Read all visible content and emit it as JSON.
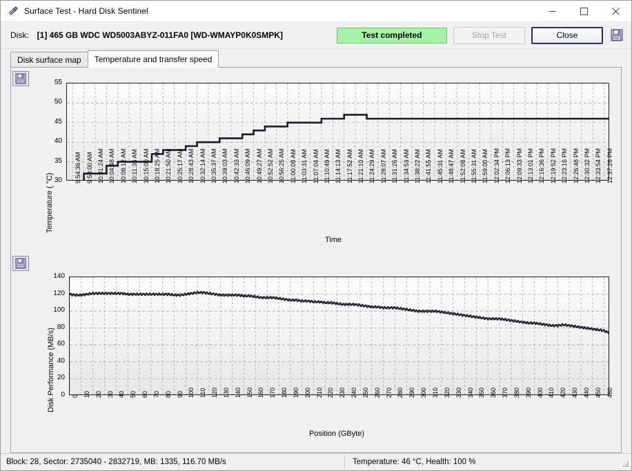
{
  "window": {
    "title": "Surface Test - Hard Disk Sentinel",
    "app_icon": "surface-test-icon",
    "minimize_label": "minimize-icon",
    "maximize_label": "maximize-icon",
    "close_label": "close-icon"
  },
  "diskbar": {
    "label": "Disk:",
    "value": "[1] 465 GB  WDC WD5003ABYZ-011FA0 [WD-WMAYP0K0SMPK]",
    "status": "Test completed",
    "status_bg": "#a6f2a6",
    "stop_button": "Stop Test",
    "close_button": "Close",
    "save_icon": "floppy-save-icon"
  },
  "tabs": [
    {
      "label": "Disk surface map",
      "active": false
    },
    {
      "label": "Temperature and transfer speed",
      "active": true
    }
  ],
  "statusbar": {
    "left": "Block: 28, Sector: 2735040 - 2832719, MB: 1335, 116.70 MB/s",
    "right": "Temperature: 46  °C,  Health: 100 %"
  },
  "chart_data": [
    {
      "id": "temperature-chart",
      "type": "line",
      "title": "",
      "xlabel": "Time",
      "ylabel": "Temperature ( °C)",
      "ylim": [
        30,
        55
      ],
      "yticks": [
        30,
        35,
        40,
        45,
        50,
        55
      ],
      "grid": true,
      "legend": null,
      "step_plot": true,
      "line_color": "#1a1a2e",
      "save_icon": "floppy-save-icon",
      "categories": [
        "9:54:36 AM",
        "9:58:00 AM",
        "10:01:24 AM",
        "10:04:48 AM",
        "10:08:12 AM",
        "10:11:36 AM",
        "10:15:00 AM",
        "10:18:25 AM",
        "10:21:50 AM",
        "10:25:17 AM",
        "10:28:43 AM",
        "10:32:14 AM",
        "10:35:37 AM",
        "10:39:03 AM",
        "10:42:33 AM",
        "10:46:09 AM",
        "10:49:27 AM",
        "10:52:52 AM",
        "10:56:25 AM",
        "11:00:08 AM",
        "11:03:31 AM",
        "11:07:04 AM",
        "11:10:49 AM",
        "11:14:13 AM",
        "11:17:52 AM",
        "11:21:10 AM",
        "11:24:29 AM",
        "11:28:07 AM",
        "11:31:26 AM",
        "11:34:53 AM",
        "11:38:22 AM",
        "11:41:55 AM",
        "11:45:31 AM",
        "11:48:47 AM",
        "11:52:08 AM",
        "11:55:31 AM",
        "11:59:00 AM",
        "12:02:34 PM",
        "12:06:13 PM",
        "12:09:33 PM",
        "12:13:01 PM",
        "12:16:36 PM",
        "12:19:52 PM",
        "12:23:16 PM",
        "12:26:48 PM",
        "12:30:32 PM",
        "12:33:54 PM",
        "12:37:26 PM"
      ],
      "values": [
        29,
        32,
        32,
        34,
        35,
        35,
        35,
        37,
        38,
        38,
        39,
        40,
        40,
        41,
        41,
        42,
        43,
        44,
        44,
        45,
        45,
        45,
        46,
        46,
        47,
        47,
        46,
        46,
        46,
        46,
        46,
        46,
        46,
        46,
        46,
        46,
        46,
        46,
        46,
        46,
        46,
        46,
        46,
        46,
        46,
        46,
        46,
        46
      ]
    },
    {
      "id": "disk-performance-chart",
      "type": "scatter",
      "title": "",
      "xlabel": "Position (GByte)",
      "ylabel": "Disk Performance (MB/s)",
      "ylim": [
        0,
        140
      ],
      "yticks": [
        0,
        20,
        40,
        60,
        80,
        100,
        120,
        140
      ],
      "xlim": [
        0,
        465
      ],
      "xticks": [
        0,
        10,
        20,
        30,
        40,
        50,
        60,
        70,
        80,
        90,
        100,
        110,
        120,
        130,
        140,
        150,
        160,
        170,
        180,
        190,
        200,
        210,
        220,
        230,
        240,
        250,
        260,
        270,
        280,
        290,
        300,
        310,
        320,
        330,
        340,
        350,
        360,
        370,
        380,
        390,
        400,
        410,
        420,
        430,
        440,
        450,
        460
      ],
      "grid": true,
      "legend": null,
      "marker_color": "#1a1a2e",
      "save_icon": "floppy-save-icon",
      "x": [
        0,
        5,
        10,
        15,
        20,
        25,
        30,
        35,
        40,
        45,
        50,
        55,
        60,
        65,
        70,
        75,
        80,
        85,
        90,
        95,
        100,
        105,
        110,
        115,
        120,
        125,
        130,
        135,
        140,
        145,
        150,
        155,
        160,
        165,
        170,
        175,
        180,
        185,
        190,
        195,
        200,
        205,
        210,
        215,
        220,
        225,
        230,
        235,
        240,
        245,
        250,
        255,
        260,
        265,
        270,
        275,
        280,
        285,
        290,
        295,
        300,
        305,
        310,
        315,
        320,
        325,
        330,
        335,
        340,
        345,
        350,
        355,
        360,
        365,
        370,
        375,
        380,
        385,
        390,
        395,
        400,
        405,
        410,
        415,
        420,
        425,
        430,
        435,
        440,
        445,
        450,
        455,
        460,
        465
      ],
      "y": [
        120,
        119,
        119,
        120,
        121,
        121,
        121,
        121,
        121,
        121,
        120,
        120,
        120,
        120,
        120,
        120,
        120,
        120,
        119,
        119,
        120,
        121,
        122,
        122,
        121,
        120,
        119,
        119,
        119,
        119,
        118,
        118,
        117,
        116,
        116,
        116,
        115,
        114,
        113,
        113,
        112,
        112,
        111,
        111,
        110,
        110,
        109,
        108,
        108,
        108,
        107,
        106,
        105,
        105,
        104,
        104,
        104,
        103,
        102,
        101,
        100,
        100,
        100,
        100,
        99,
        98,
        97,
        96,
        95,
        94,
        93,
        92,
        91,
        91,
        91,
        90,
        89,
        88,
        87,
        86,
        86,
        85,
        84,
        83,
        83,
        84,
        83,
        82,
        81,
        80,
        79,
        78,
        77,
        74,
        71
      ]
    }
  ]
}
